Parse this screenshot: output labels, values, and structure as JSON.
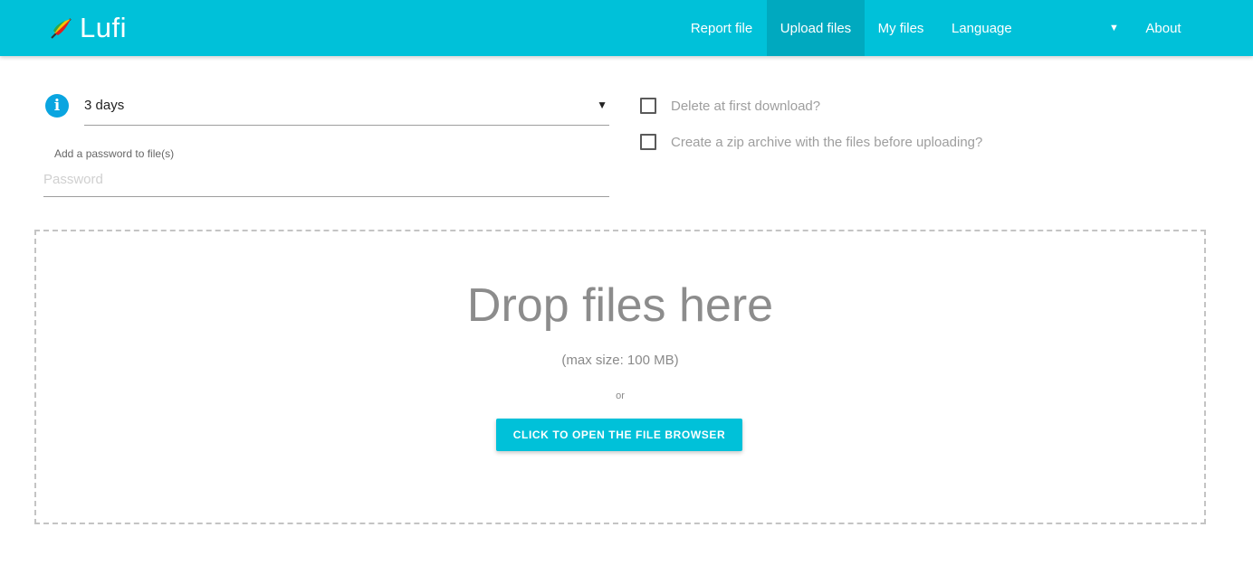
{
  "header": {
    "brand": "Lufi",
    "nav": [
      {
        "label": "Report file"
      },
      {
        "label": "Upload files",
        "active": true
      },
      {
        "label": "My files"
      },
      {
        "label": "Language"
      },
      {
        "label": "About"
      }
    ],
    "lang_arrow": "▼"
  },
  "options": {
    "info_icon": "i",
    "delay_value": "3 days",
    "select_arrow": "▼",
    "password_label": "Add a password to file(s)",
    "password_placeholder": "Password",
    "delete_first_download": "Delete at first download?",
    "zip_archive": "Create a zip archive with the files before uploading?"
  },
  "dropzone": {
    "title": "Drop files here",
    "max_size": "(max size: 100 MB)",
    "or": "or",
    "button": "CLICK TO OPEN THE FILE BROWSER"
  },
  "colors": {
    "accent": "#00c1d9",
    "accent_active": "#00a9bf",
    "info": "#0aa5e0"
  },
  "icons": {
    "brand": "lufi-feather-logo-icon",
    "info": "info-icon",
    "dropdown": "chevron-down-icon",
    "checkbox": "checkbox-icon"
  }
}
